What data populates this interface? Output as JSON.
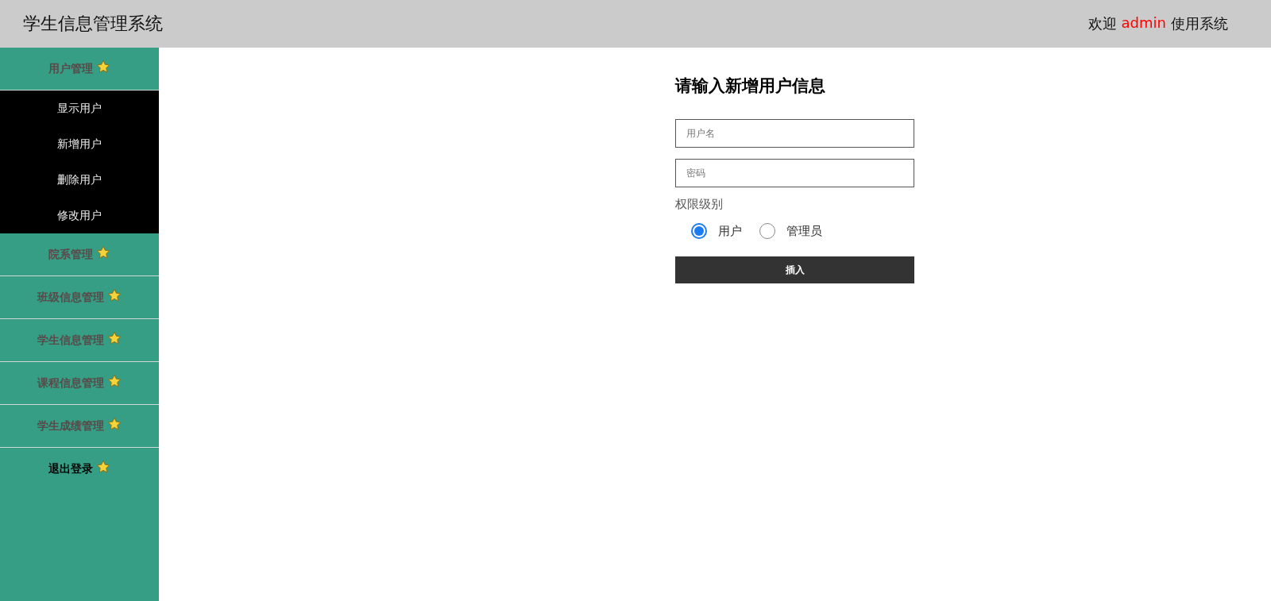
{
  "header": {
    "title": "学生信息管理系统",
    "welcome_prefix": "欢迎",
    "user": "admin",
    "welcome_suffix": "使用系统"
  },
  "sidebar": {
    "items": [
      {
        "label": "用户管理",
        "kind": "group",
        "expanded": true,
        "children": [
          {
            "label": "显示用户"
          },
          {
            "label": "新增用户"
          },
          {
            "label": "删除用户"
          },
          {
            "label": "修改用户"
          }
        ]
      },
      {
        "label": "院系管理",
        "kind": "group"
      },
      {
        "label": "班级信息管理",
        "kind": "group"
      },
      {
        "label": "学生信息管理",
        "kind": "group"
      },
      {
        "label": "课程信息管理",
        "kind": "group"
      },
      {
        "label": "学生成绩管理",
        "kind": "group"
      },
      {
        "label": "退出登录",
        "kind": "logout"
      }
    ]
  },
  "form": {
    "title": "请输入新增用户信息",
    "fields": [
      {
        "placeholder": "用户名"
      },
      {
        "placeholder": "密码"
      }
    ],
    "role_label": "权限级别",
    "roles": [
      {
        "label": "用户",
        "selected": true
      },
      {
        "label": "管理员",
        "selected": false
      }
    ],
    "submit": "插入"
  }
}
